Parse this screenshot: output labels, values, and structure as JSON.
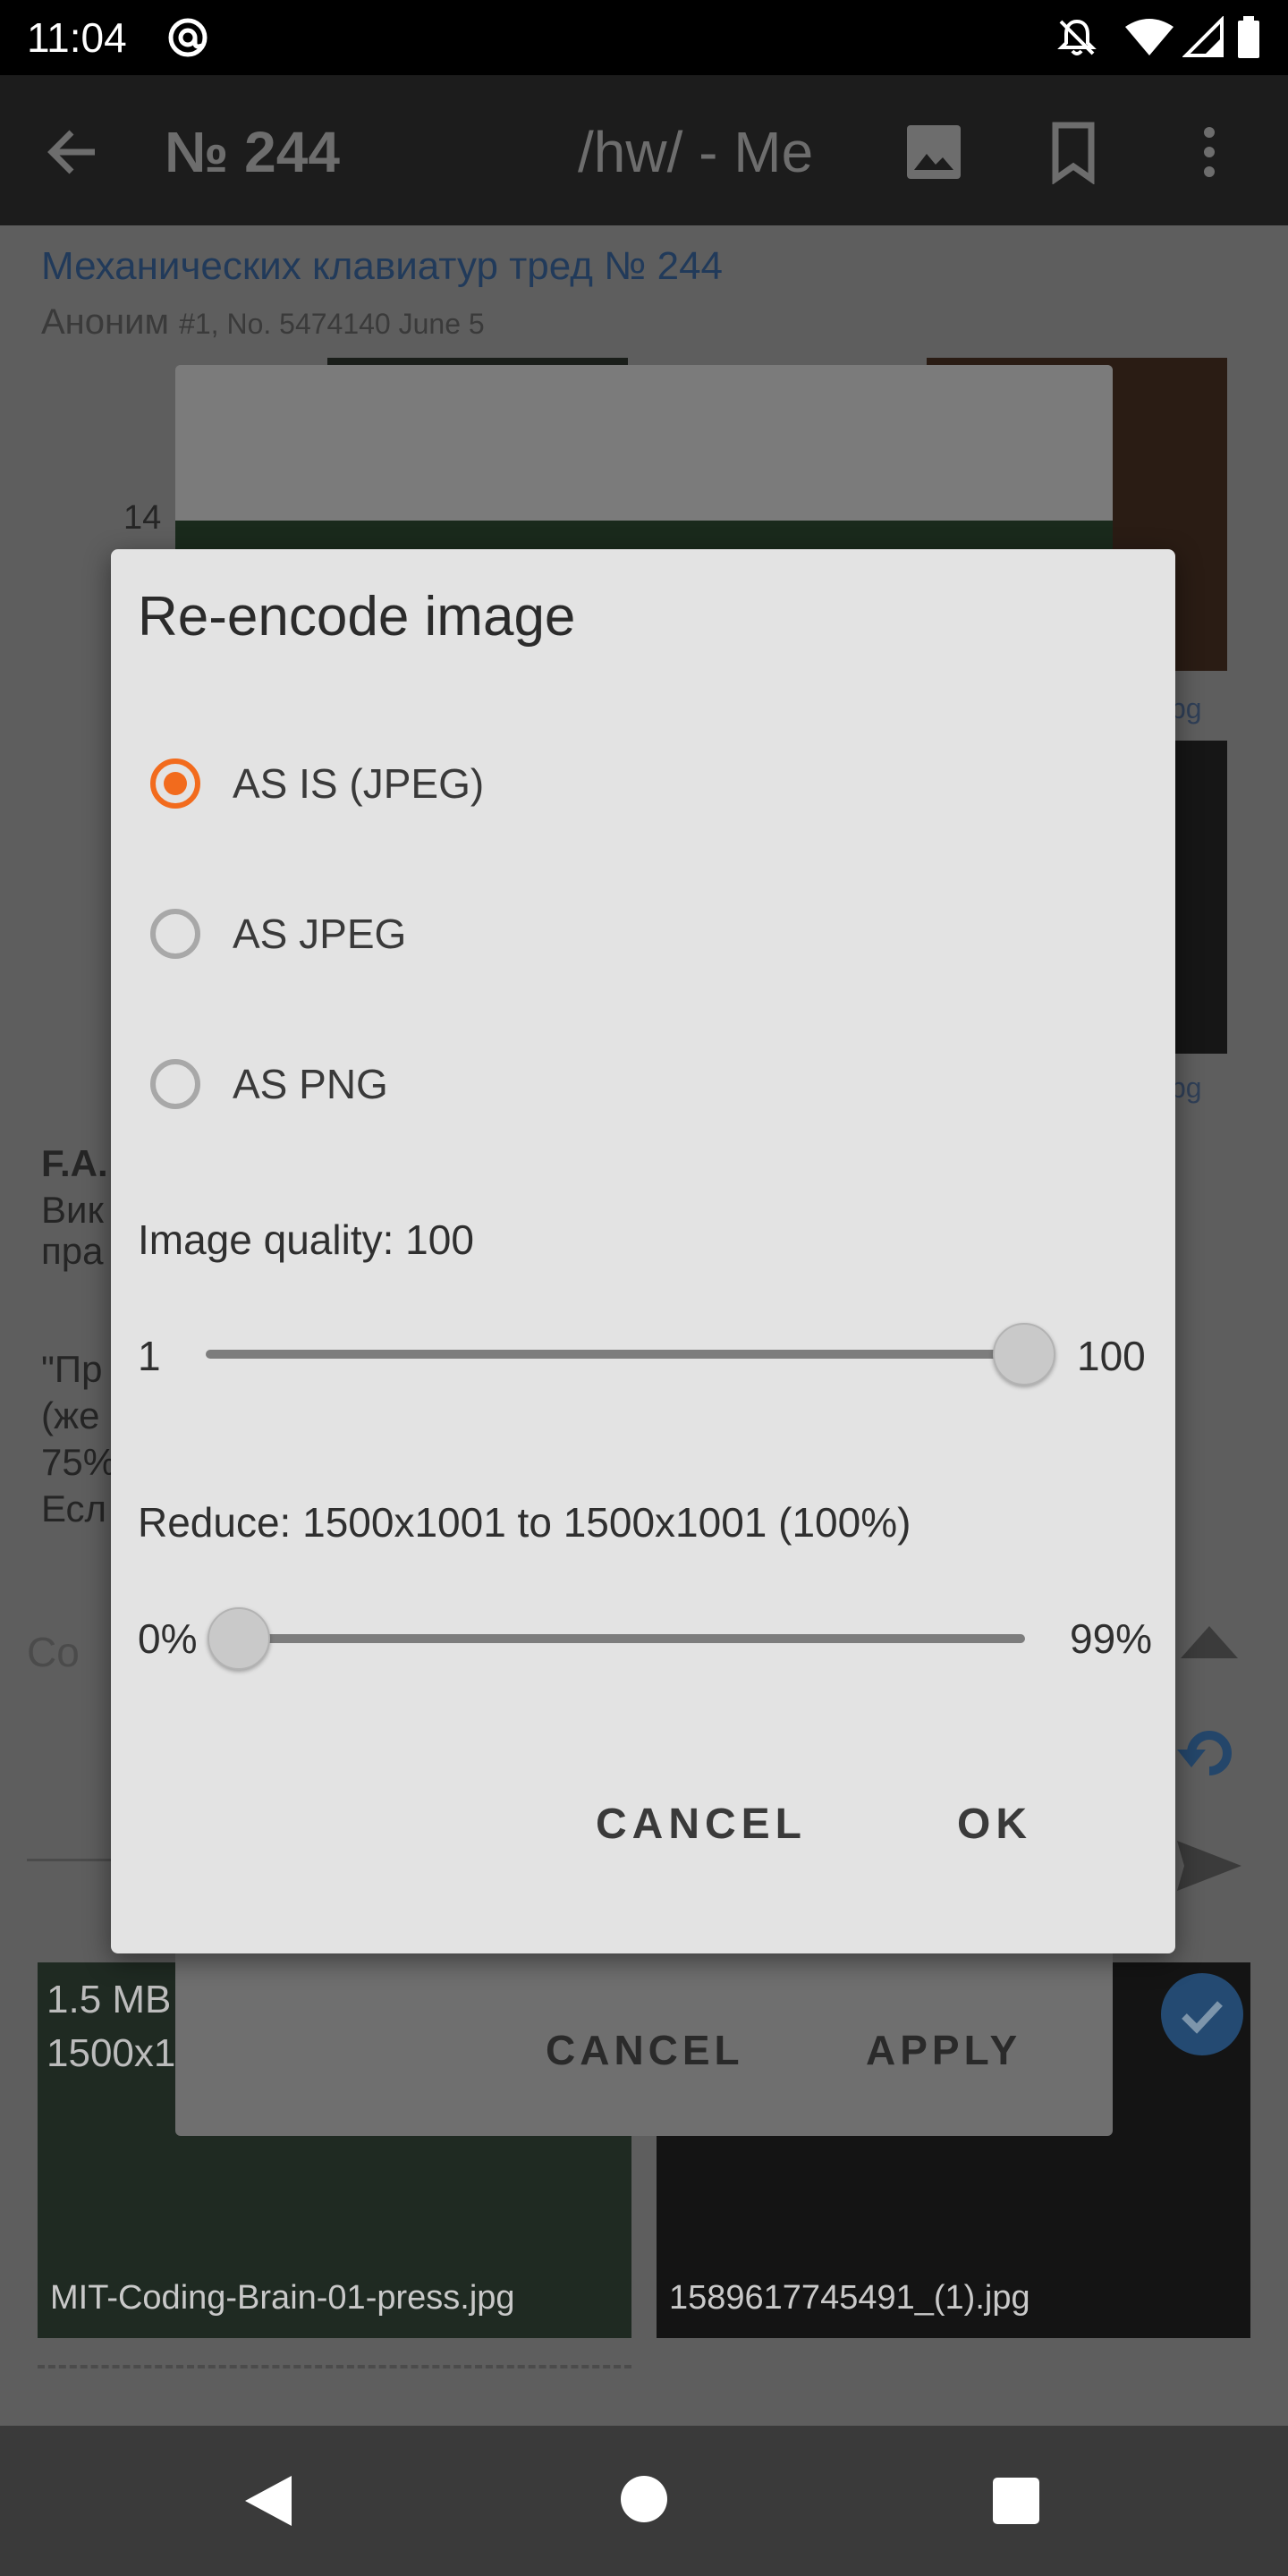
{
  "status_bar": {
    "time": "11:04",
    "icons": [
      "at-sign-icon",
      "notifications-off-icon",
      "wifi-icon",
      "signal-icon",
      "battery-icon"
    ]
  },
  "toolbar": {
    "title": "№ 244",
    "board": "/hw/ - Me",
    "icons": [
      "back-arrow-icon",
      "image-icon",
      "bookmark-icon",
      "more-vert-icon"
    ]
  },
  "thread": {
    "title": "Механических клавиатур тред № 244",
    "author": "Аноним",
    "post_meta": "#1, No. 5474140 June 5",
    "number_fragment": "14",
    "file_suffix_1": ".jpg",
    "file_suffix_2": ".jpg",
    "faq_fragment": "F.A.",
    "text_lines": [
      "Вик",
      "пра",
      "",
      "\"Пр",
      "(же",
      "75%",
      "Есл"
    ],
    "text_right_fragment": "/",
    "comment_placeholder": "Co"
  },
  "attachments": [
    {
      "size": "1.5 MB",
      "dims": "1500x1",
      "name": "MIT-Coding-Brain-01-press.jpg"
    },
    {
      "name": "1589617745491_(1).jpg",
      "checked": true
    }
  ],
  "underlying_dialog": {
    "cancel": "CANCEL",
    "apply": "APPLY"
  },
  "dialog": {
    "title": "Re-encode image",
    "options": [
      {
        "label": "AS IS (JPEG)",
        "selected": true
      },
      {
        "label": "AS JPEG",
        "selected": false
      },
      {
        "label": "AS PNG",
        "selected": false
      }
    ],
    "quality": {
      "label": "Image quality: 100",
      "min": "1",
      "max": "100",
      "value": 100
    },
    "reduce": {
      "label": "Reduce: 1500x1001 to 1500x1001 (100%)",
      "min": "0%",
      "max": "99%",
      "value": 0
    },
    "cancel": "CANCEL",
    "ok": "OK"
  },
  "colors": {
    "accent": "#f26b1d",
    "dialog_bg": "#e3e3e3",
    "check_blue": "#3a82c8"
  }
}
